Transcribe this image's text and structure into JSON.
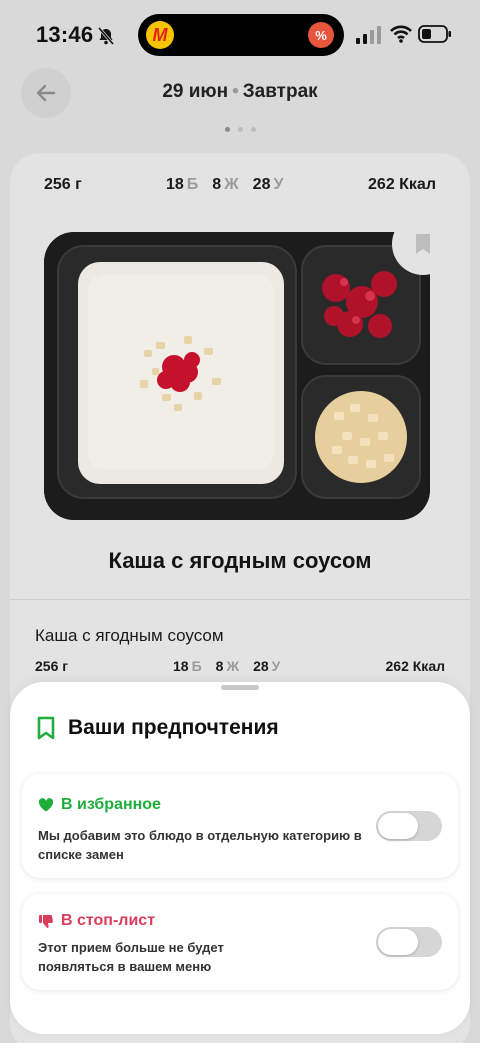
{
  "status_bar": {
    "time": "13:46",
    "island_app_letter": "M",
    "island_badge": "%"
  },
  "header": {
    "date": "29 июн",
    "separator": "•",
    "meal": "Завтрак"
  },
  "meal_card": {
    "weight": "256 г",
    "protein_value": "18",
    "protein_unit": "Б",
    "fat_value": "8",
    "fat_unit": "Ж",
    "carbs_value": "28",
    "carbs_unit": "У",
    "kcal": "262 Ккал",
    "dish_title": "Каша с ягодным соусом",
    "section_title": "Каша с ягодным соусом",
    "row2": {
      "weight": "256 г",
      "protein_value": "18",
      "protein_unit": "Б",
      "fat_value": "8",
      "fat_unit": "Ж",
      "carbs_value": "28",
      "carbs_unit": "У",
      "kcal": "262 Ккал"
    }
  },
  "sheet": {
    "title": "Ваши предпочтения",
    "favorite": {
      "label": "В избранное",
      "description": "Мы добавим это блюдо в отдельную категорию в списке замен",
      "enabled": false,
      "color": "#1fae3c"
    },
    "stoplist": {
      "label": "В стоп-лист",
      "description": "Этот прием больше не будет появляться в вашем меню",
      "enabled": false,
      "color": "#d93d5c"
    }
  },
  "colors": {
    "accent_green": "#1fae3c",
    "accent_red": "#d93d5c"
  }
}
